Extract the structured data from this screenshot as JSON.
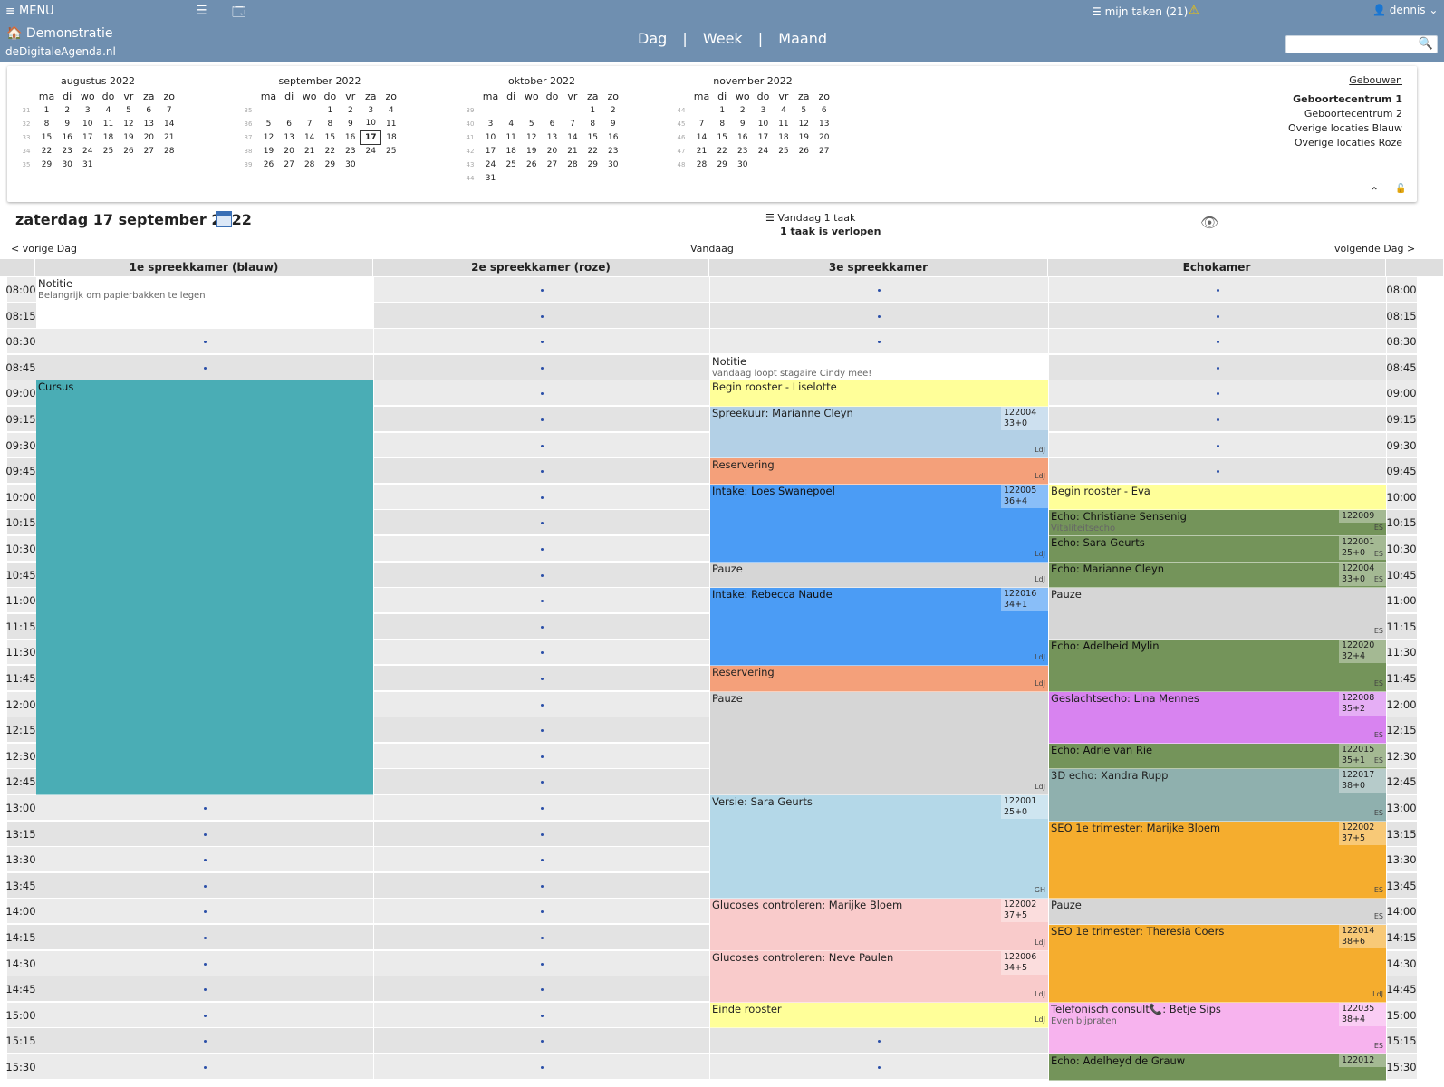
{
  "header": {
    "menu": "≡ MENU",
    "icon_list": "list-icon",
    "icon_card": "card-icon",
    "org": "🏠 Demonstratie",
    "site": "deDigitaleAgenda.nl",
    "tasks": "☰ mijn taken (21)",
    "warning": "⚠",
    "user": "👤 dennis ⌄",
    "views": [
      "Dag",
      "|",
      "Week",
      "|",
      "Maand"
    ],
    "search_placeholder": "",
    "search_icon": "🔍"
  },
  "minicals": [
    {
      "title": "augustus 2022",
      "weeks": [
        [
          "31",
          "1",
          "2",
          "3",
          "4",
          "5",
          "6",
          "7"
        ],
        [
          "32",
          "8",
          "9",
          "10",
          "11",
          "12",
          "13",
          "14"
        ],
        [
          "33",
          "15",
          "16",
          "17",
          "18",
          "19",
          "20",
          "21"
        ],
        [
          "34",
          "22",
          "23",
          "24",
          "25",
          "26",
          "27",
          "28"
        ],
        [
          "35",
          "29",
          "30",
          "31",
          "",
          "",
          "",
          ""
        ]
      ]
    },
    {
      "title": "september 2022",
      "weeks": [
        [
          "35",
          "",
          "",
          "",
          "1",
          "2",
          "3",
          "4"
        ],
        [
          "36",
          "5",
          "6",
          "7",
          "8",
          "9",
          "10",
          "11"
        ],
        [
          "37",
          "12",
          "13",
          "14",
          "15",
          "16",
          "17",
          "18"
        ],
        [
          "38",
          "19",
          "20",
          "21",
          "22",
          "23",
          "24",
          "25"
        ],
        [
          "39",
          "26",
          "27",
          "28",
          "29",
          "30",
          "",
          ""
        ]
      ]
    },
    {
      "title": "oktober 2022",
      "weeks": [
        [
          "39",
          "",
          "",
          "",
          "",
          "",
          "1",
          "2"
        ],
        [
          "40",
          "3",
          "4",
          "5",
          "6",
          "7",
          "8",
          "9"
        ],
        [
          "41",
          "10",
          "11",
          "12",
          "13",
          "14",
          "15",
          "16"
        ],
        [
          "42",
          "17",
          "18",
          "19",
          "20",
          "21",
          "22",
          "23"
        ],
        [
          "43",
          "24",
          "25",
          "26",
          "27",
          "28",
          "29",
          "30"
        ],
        [
          "44",
          "31",
          "",
          "",
          "",
          "",
          "",
          ""
        ]
      ]
    },
    {
      "title": "november 2022",
      "weeks": [
        [
          "44",
          "",
          "1",
          "2",
          "3",
          "4",
          "5",
          "6"
        ],
        [
          "45",
          "7",
          "8",
          "9",
          "10",
          "11",
          "12",
          "13"
        ],
        [
          "46",
          "14",
          "15",
          "16",
          "17",
          "18",
          "19",
          "20"
        ],
        [
          "47",
          "21",
          "22",
          "23",
          "24",
          "25",
          "26",
          "27"
        ],
        [
          "48",
          "28",
          "29",
          "30",
          "",
          "",
          "",
          ""
        ]
      ]
    }
  ],
  "weekdays": [
    "ma",
    "di",
    "wo",
    "do",
    "vr",
    "za",
    "zo"
  ],
  "selected_day": "17",
  "locations": {
    "link": "Gebouwen",
    "items": [
      "Geboortecentrum 1",
      "Geboortecentrum 2",
      "Overige locaties Blauw",
      "Overige locaties Roze"
    ]
  },
  "panel_icons": {
    "collapse": "⌃",
    "lock": "🔓"
  },
  "day": {
    "title": "zaterdag 17 september 2022",
    "prev": "< vorige Dag",
    "today": "Vandaag",
    "next": "volgende Dag >"
  },
  "taskinfo": {
    "line1": "☰ Vandaag 1 taak",
    "line2": "1 taak is verlopen"
  },
  "eye": "👁",
  "columns": [
    "1e spreekkamer (blauw)",
    "2e spreekkamer (roze)",
    "3e spreekkamer",
    "Echokamer"
  ],
  "times": [
    "08:00",
    "08:15",
    "08:30",
    "08:45",
    "09:00",
    "09:15",
    "09:30",
    "09:45",
    "10:00",
    "10:15",
    "10:30",
    "10:45",
    "11:00",
    "11:15",
    "11:30",
    "11:45",
    "12:00",
    "12:15",
    "12:30",
    "12:45",
    "13:00",
    "13:15",
    "13:30",
    "13:45",
    "14:00",
    "14:15",
    "14:30",
    "14:45",
    "15:00",
    "15:15",
    "15:30"
  ],
  "events": [
    {
      "col": 0,
      "start": 0,
      "len": 2,
      "title": "Notitie",
      "sub": "Belangrijk om papierbakken te legen",
      "color": "#ffffff"
    },
    {
      "col": 0,
      "start": 4,
      "len": 16,
      "title": "Cursus",
      "color": "#4aadb5"
    },
    {
      "col": 2,
      "start": 3,
      "len": 1,
      "title": "Notitie",
      "sub": "vandaag loopt stagaire Cindy mee!",
      "color": "#ffffff"
    },
    {
      "col": 2,
      "start": 4,
      "len": 1,
      "title": "Begin rooster - Liselotte",
      "color": "#ffff99"
    },
    {
      "col": 2,
      "start": 5,
      "len": 2,
      "title": "Spreekuur: Marianne Cleyn",
      "num": "122004 33+0",
      "initials": "LdJ",
      "color": "#b3d0e6"
    },
    {
      "col": 2,
      "start": 7,
      "len": 1,
      "title": "Reservering",
      "initials": "LdJ",
      "color": "#f4a07a"
    },
    {
      "col": 2,
      "start": 8,
      "len": 3,
      "title": "Intake: Loes Swanepoel",
      "num": "122005 36+4",
      "initials": "LdJ",
      "color": "#4b9cf5"
    },
    {
      "col": 2,
      "start": 11,
      "len": 1,
      "title": "Pauze",
      "initials": "LdJ",
      "color": "#d6d6d6"
    },
    {
      "col": 2,
      "start": 12,
      "len": 3,
      "title": "Intake: Rebecca Naude",
      "num": "122016 34+1",
      "initials": "LdJ",
      "color": "#4b9cf5"
    },
    {
      "col": 2,
      "start": 15,
      "len": 1,
      "title": "Reservering",
      "initials": "LdJ",
      "color": "#f4a07a"
    },
    {
      "col": 2,
      "start": 16,
      "len": 4,
      "title": "Pauze",
      "initials": "LdJ",
      "color": "#d6d6d6"
    },
    {
      "col": 2,
      "start": 20,
      "len": 4,
      "title": "Versie: Sara Geurts",
      "num": "122001 25+0",
      "initials": "GH",
      "color": "#b4d8e8"
    },
    {
      "col": 2,
      "start": 24,
      "len": 2,
      "title": "Glucoses controleren: Marijke Bloem",
      "num": "122002 37+5",
      "initials": "LdJ",
      "color": "#f9cbcb"
    },
    {
      "col": 2,
      "start": 26,
      "len": 2,
      "title": "Glucoses controleren: Neve Paulen",
      "num": "122006 34+5",
      "initials": "LdJ",
      "color": "#f9cbcb"
    },
    {
      "col": 2,
      "start": 28,
      "len": 1,
      "title": "Einde rooster",
      "initials": "LdJ",
      "color": "#ffff99"
    },
    {
      "col": 3,
      "start": 8,
      "len": 1,
      "title": "Begin rooster - Eva",
      "color": "#ffff99"
    },
    {
      "col": 3,
      "start": 9,
      "len": 1,
      "title": "Echo: Christiane Sensenig",
      "sub": "Vitaliteitsecho",
      "num": "122009",
      "initials": "ES",
      "color": "#74945a"
    },
    {
      "col": 3,
      "start": 10,
      "len": 1,
      "title": "Echo: Sara Geurts",
      "num": "122001 25+0",
      "initials": "ES",
      "color": "#74945a"
    },
    {
      "col": 3,
      "start": 11,
      "len": 1,
      "title": "Echo: Marianne Cleyn",
      "num": "122004 33+0",
      "initials": "ES",
      "color": "#74945a"
    },
    {
      "col": 3,
      "start": 12,
      "len": 2,
      "title": "Pauze",
      "initials": "ES",
      "color": "#d6d6d6"
    },
    {
      "col": 3,
      "start": 14,
      "len": 2,
      "title": "Echo: Adelheid Mylin",
      "num": "122020 32+4",
      "initials": "ES",
      "color": "#74945a"
    },
    {
      "col": 3,
      "start": 16,
      "len": 2,
      "title": "Geslachtsecho: Lina Mennes",
      "num": "122008 35+2",
      "initials": "ES",
      "color": "#d883f0"
    },
    {
      "col": 3,
      "start": 18,
      "len": 1,
      "title": "Echo: Adrie van Rie",
      "num": "122015 35+1",
      "initials": "ES",
      "color": "#74945a"
    },
    {
      "col": 3,
      "start": 19,
      "len": 2,
      "title": "3D echo: Xandra Rupp",
      "num": "122017 38+0",
      "initials": "ES",
      "color": "#8fb0ae"
    },
    {
      "col": 3,
      "start": 21,
      "len": 3,
      "title": "SEO 1e trimester: Marijke Bloem",
      "num": "122002 37+5",
      "initials": "ES",
      "color": "#f5ad2e"
    },
    {
      "col": 3,
      "start": 24,
      "len": 1,
      "title": "Pauze",
      "initials": "ES",
      "color": "#d6d6d6"
    },
    {
      "col": 3,
      "start": 25,
      "len": 3,
      "title": "SEO 1e trimester: Theresia Coers",
      "num": "122014 38+6",
      "initials": "LdJ",
      "color": "#f5ad2e"
    },
    {
      "col": 3,
      "start": 28,
      "len": 2,
      "title": "Telefonisch consult📞: Betje Sips",
      "sub": "Even bijpraten",
      "num": "122035 38+4",
      "initials": "ES",
      "color": "#f7b3ee"
    },
    {
      "col": 3,
      "start": 30,
      "len": 1,
      "title": "Echo: Adelheyd de Grauw",
      "num": "122012",
      "color": "#74945a"
    }
  ]
}
